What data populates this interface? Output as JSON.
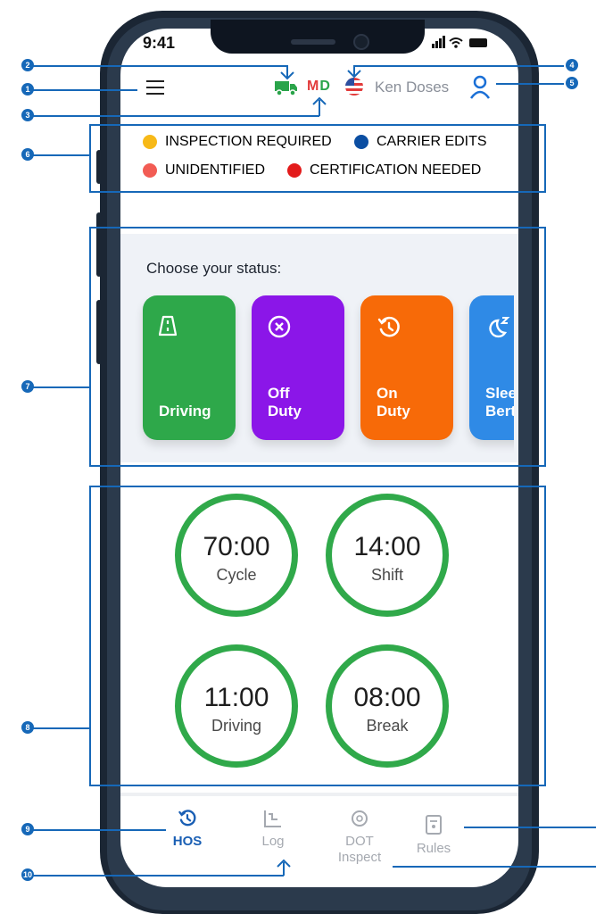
{
  "status_bar": {
    "time": "9:41"
  },
  "header": {
    "region_code": {
      "m": "M",
      "d": "D"
    },
    "username": "Ken Doses",
    "icons": [
      "menu-icon",
      "truck-icon",
      "us-flag-icon",
      "user-icon"
    ]
  },
  "legend": [
    {
      "label": "INSPECTION REQUIRED",
      "color": "#f7b918"
    },
    {
      "label": "CARRIER EDITS",
      "color": "#0b4ea2"
    },
    {
      "label": "UNIDENTIFIED",
      "color": "#f25c54"
    },
    {
      "label": "CERTIFICATION NEEDED",
      "color": "#e31b1b"
    }
  ],
  "status": {
    "title": "Choose your status:",
    "cards": [
      {
        "line1": "Driving",
        "line2": "",
        "color": "#2ea84a",
        "icon": "road-icon"
      },
      {
        "line1": "Off",
        "line2": "Duty",
        "color": "#8b16e8",
        "icon": "close-circle-icon"
      },
      {
        "line1": "On",
        "line2": "Duty",
        "color": "#f76a08",
        "icon": "clock-rotate-icon"
      },
      {
        "line1": "Sleeper",
        "line2": "Berth",
        "color": "#2f8ae6",
        "icon": "sleep-icon"
      }
    ]
  },
  "timers": [
    {
      "value": "70:00",
      "label": "Cycle"
    },
    {
      "value": "14:00",
      "label": "Shift"
    },
    {
      "value": "11:00",
      "label": "Driving"
    },
    {
      "value": "08:00",
      "label": "Break"
    }
  ],
  "nav": [
    {
      "label": "HOS",
      "icon": "clock-rotate-icon",
      "active": true
    },
    {
      "label": "Log",
      "icon": "log-chart-icon",
      "active": false
    },
    {
      "label": "DOT Inspect",
      "line1": "DOT",
      "line2": "Inspect",
      "icon": "inspect-badge-icon",
      "active": false
    },
    {
      "label": "Rules",
      "icon": "rules-document-icon",
      "active": false
    }
  ],
  "annotations": [
    "1",
    "2",
    "3",
    "4",
    "5",
    "6",
    "7",
    "8",
    "9",
    "10"
  ]
}
